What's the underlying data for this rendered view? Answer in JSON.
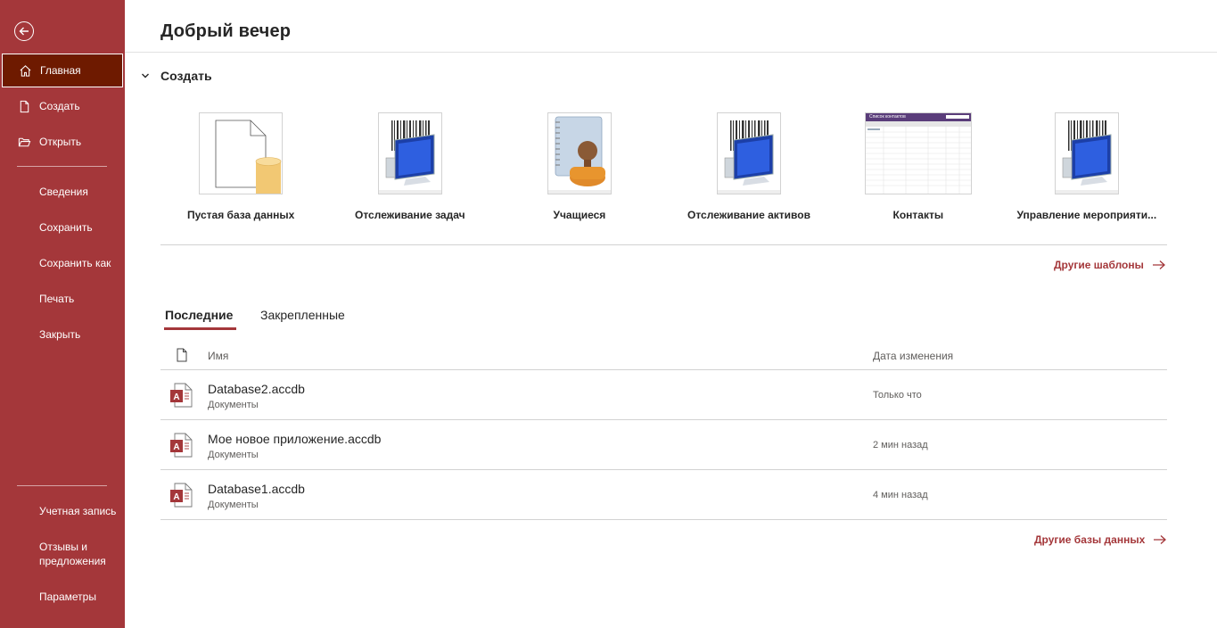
{
  "sidebar": {
    "items": [
      {
        "label": "Главная"
      },
      {
        "label": "Создать"
      },
      {
        "label": "Открыть"
      },
      {
        "label": "Сведения"
      },
      {
        "label": "Сохранить"
      },
      {
        "label": "Сохранить как"
      },
      {
        "label": "Печать"
      },
      {
        "label": "Закрыть"
      },
      {
        "label": "Учетная запись"
      },
      {
        "label": "Отзывы и предложения"
      },
      {
        "label": "Параметры"
      }
    ]
  },
  "main": {
    "greeting": "Добрый вечер",
    "create_section": "Создать",
    "templates": [
      {
        "label": "Пустая база данных",
        "icon": "blank-database-icon"
      },
      {
        "label": "Отслеживание задач",
        "icon": "barcode-computer-icon"
      },
      {
        "label": "Учащиеся",
        "icon": "student-contact-icon"
      },
      {
        "label": "Отслеживание активов",
        "icon": "barcode-computer-icon"
      },
      {
        "label": "Контакты",
        "icon": "contacts-grid-icon",
        "thumb_title": "Список контактов"
      },
      {
        "label": "Управление мероприяти...",
        "icon": "barcode-computer-icon"
      }
    ],
    "more_templates": "Другие шаблоны",
    "tabs": [
      {
        "label": "Последние",
        "active": true
      },
      {
        "label": "Закрепленные",
        "active": false
      }
    ],
    "columns": {
      "name": "Имя",
      "date": "Дата изменения"
    },
    "files": [
      {
        "name": "Database2.accdb",
        "path": "Документы",
        "date": "Только что"
      },
      {
        "name": "Мое новое приложение.accdb",
        "path": "Документы",
        "date": "2 мин назад"
      },
      {
        "name": "Database1.accdb",
        "path": "Документы",
        "date": "4 мин назад"
      }
    ],
    "more_databases": "Другие базы данных"
  },
  "colors": {
    "accent": "#a4373a",
    "active_nav": "#6e1a00"
  }
}
